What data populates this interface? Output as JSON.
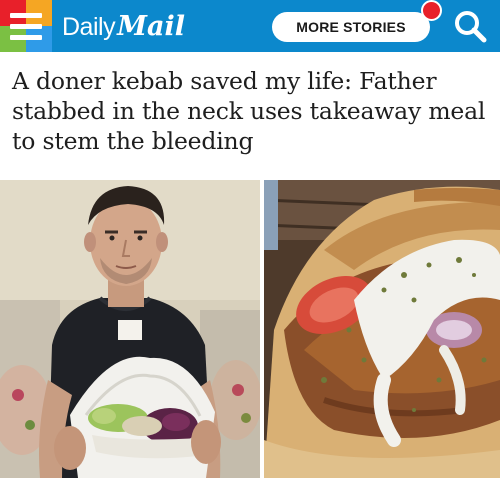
{
  "header": {
    "brand_part1": "Daily",
    "brand_part2": "Mail",
    "more_label": "MORE STORIES",
    "background_color": "#0c88cc",
    "notification_color": "#e8202a",
    "menu_icon": "hamburger-menu-icon",
    "search_icon": "search-icon",
    "menu_colors": [
      "#e8202a",
      "#f5a623",
      "#7bc043",
      "#2f9be8"
    ]
  },
  "article": {
    "headline": "A doner kebab saved my life: Father stabbed in the neck uses takeaway meal to stem the bleeding"
  },
  "images": {
    "left": "photo-man-holding-kebab",
    "right": "photo-doner-kebab-closeup"
  }
}
